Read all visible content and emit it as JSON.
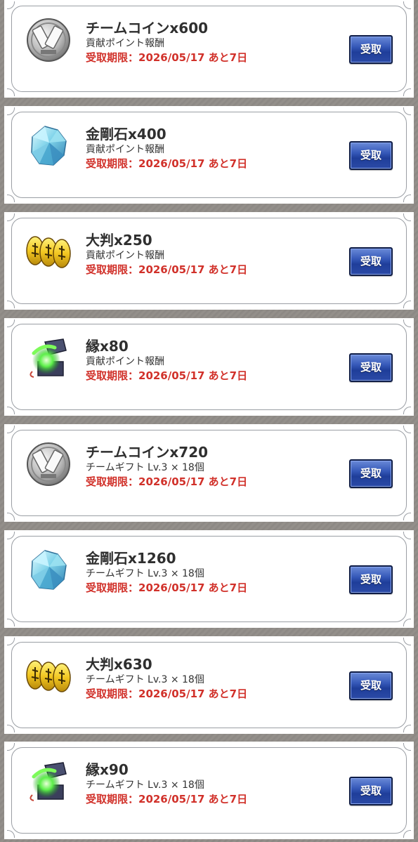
{
  "button_label": "受取",
  "rewards": [
    {
      "icon": "team-coin-icon",
      "title": "チームコインx600",
      "source": "貢献ポイント報酬",
      "deadline": "受取期限：2026/05/17 あと7日"
    },
    {
      "icon": "diamond-icon",
      "title": "金剛石x400",
      "source": "貢献ポイント報酬",
      "deadline": "受取期限：2026/05/17 あと7日"
    },
    {
      "icon": "gold-oban-icon",
      "title": "大判x250",
      "source": "貢献ポイント報酬",
      "deadline": "受取期限：2026/05/17 あと7日"
    },
    {
      "icon": "en-box-icon",
      "title": "縁x80",
      "source": "貢献ポイント報酬",
      "deadline": "受取期限：2026/05/17 あと7日"
    },
    {
      "icon": "team-coin-icon",
      "title": "チームコインx720",
      "source": "チームギフト Lv.3 × 18個",
      "deadline": "受取期限：2026/05/17 あと7日"
    },
    {
      "icon": "diamond-icon",
      "title": "金剛石x1260",
      "source": "チームギフト Lv.3 × 18個",
      "deadline": "受取期限：2026/05/17 あと7日"
    },
    {
      "icon": "gold-oban-icon",
      "title": "大判x630",
      "source": "チームギフト Lv.3 × 18個",
      "deadline": "受取期限：2026/05/17 あと7日"
    },
    {
      "icon": "en-box-icon",
      "title": "縁x90",
      "source": "チームギフト Lv.3 × 18個",
      "deadline": "受取期限：2026/05/17 あと7日"
    }
  ],
  "colors": {
    "deadline": "#d1312a",
    "button": "#2b4aa6",
    "title": "#2f2f2f"
  }
}
